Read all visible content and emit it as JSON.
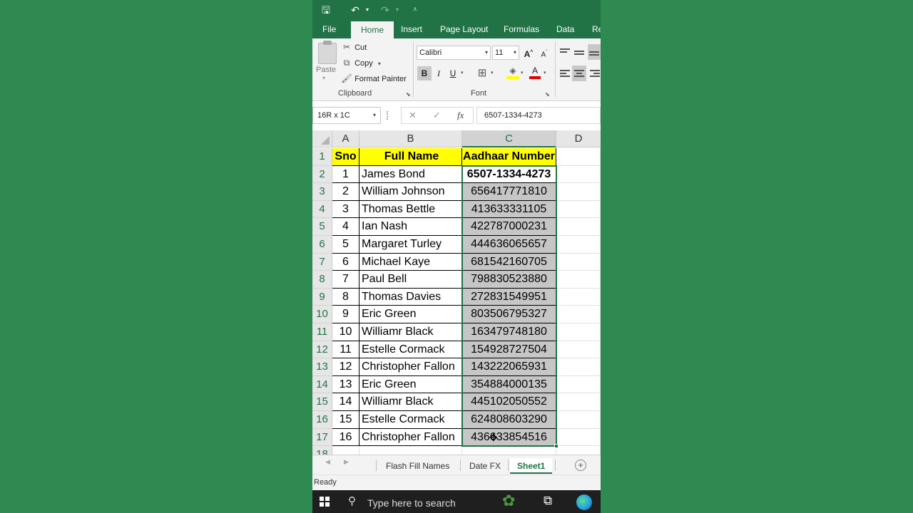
{
  "qat": {
    "save_icon": "save-icon",
    "undo_icon": "undo-icon",
    "redo_icon": "redo-icon",
    "customize_icon": "customize-qat-icon"
  },
  "tabs": [
    "File",
    "Home",
    "Insert",
    "Page Layout",
    "Formulas",
    "Data",
    "Re"
  ],
  "ribbon": {
    "paste_label": "Paste",
    "cut_label": "Cut",
    "copy_label": "Copy",
    "format_painter_label": "Format Painter",
    "clipboard_group": "Clipboard",
    "font_name": "Calibri",
    "font_size": "11",
    "font_group": "Font",
    "bold": "B",
    "italic": "I",
    "underline": "U",
    "font_color_letter": "A",
    "grow_font": "A",
    "shrink_font": "A"
  },
  "formula_bar": {
    "name_box": "16R x 1C",
    "cancel": "✕",
    "enter": "✓",
    "fx": "fx",
    "value": "6507-1334-4273"
  },
  "columns": [
    "A",
    "B",
    "C",
    "D"
  ],
  "rows": [
    {
      "num": "1",
      "a": "Sno",
      "b": "Full Name",
      "c": "Aadhaar Number"
    },
    {
      "num": "2",
      "a": "1",
      "b": "James Bond",
      "c": "6507-1334-4273"
    },
    {
      "num": "3",
      "a": "2",
      "b": "William Johnson",
      "c": "656417771810"
    },
    {
      "num": "4",
      "a": "3",
      "b": "Thomas Bettle",
      "c": "413633331105"
    },
    {
      "num": "5",
      "a": "4",
      "b": "Ian Nash",
      "c": "422787000231"
    },
    {
      "num": "6",
      "a": "5",
      "b": "Margaret Turley",
      "c": "444636065657"
    },
    {
      "num": "7",
      "a": "6",
      "b": "Michael Kaye",
      "c": "681542160705"
    },
    {
      "num": "8",
      "a": "7",
      "b": "Paul Bell",
      "c": "798830523880"
    },
    {
      "num": "9",
      "a": "8",
      "b": "Thomas Davies",
      "c": "272831549951"
    },
    {
      "num": "10",
      "a": "9",
      "b": "Eric Green",
      "c": "803506795327"
    },
    {
      "num": "11",
      "a": "10",
      "b": "Williamr Black",
      "c": "163479748180"
    },
    {
      "num": "12",
      "a": "11",
      "b": "Estelle Cormack",
      "c": "154928727504"
    },
    {
      "num": "13",
      "a": "12",
      "b": "Christopher Fallon",
      "c": "143222065931"
    },
    {
      "num": "14",
      "a": "13",
      "b": "Eric Green",
      "c": "354884000135"
    },
    {
      "num": "15",
      "a": "14",
      "b": "Williamr Black",
      "c": "445102050552"
    },
    {
      "num": "16",
      "a": "15",
      "b": "Estelle Cormack",
      "c": "624808603290"
    },
    {
      "num": "17",
      "a": "16",
      "b": "Christopher Fallon",
      "c": "436633854516"
    },
    {
      "num": "18",
      "a": "",
      "b": "",
      "c": ""
    }
  ],
  "sheet_tabs": [
    "Flash Fill Names",
    "Date FX",
    "Sheet1"
  ],
  "active_sheet": "Sheet1",
  "status": "Ready",
  "taskbar": {
    "search_placeholder": "Type here to search"
  },
  "colors": {
    "excel_green": "#217346",
    "header_fill": "#ffff00",
    "selection_fill": "#c6c6c6"
  }
}
